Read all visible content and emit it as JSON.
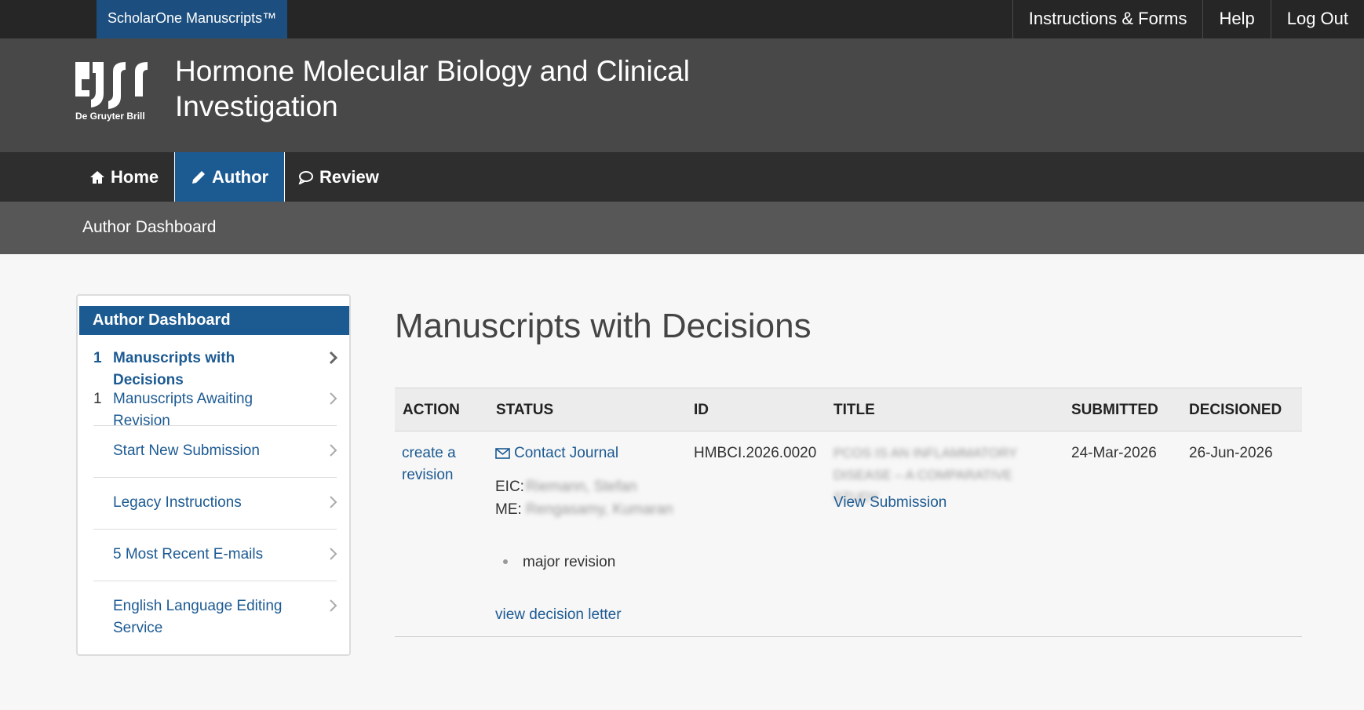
{
  "topbar": {
    "brand": "ScholarOne Manuscripts™",
    "links": [
      "Instructions & Forms",
      "Help",
      "Log Out"
    ]
  },
  "header": {
    "logo_text": "De Gruyter Brill",
    "journal_title": "Hormone Molecular Biology and Clinical Investigation"
  },
  "nav": {
    "items": [
      {
        "label": "Home",
        "icon": "home-icon"
      },
      {
        "label": "Author",
        "icon": "pencil-icon",
        "active": true
      },
      {
        "label": "Review",
        "icon": "speech-bubble-icon"
      }
    ]
  },
  "breadcrumb": "Author Dashboard",
  "sidebar": {
    "title": "Author Dashboard",
    "items": [
      {
        "count": "1",
        "label": "Manuscripts with Decisions"
      },
      {
        "count": "1",
        "label": "Manuscripts Awaiting Revision"
      },
      {
        "count": "",
        "label": "Start New Submission"
      },
      {
        "count": "",
        "label": "Legacy Instructions"
      },
      {
        "count": "",
        "label": "5 Most Recent E-mails"
      },
      {
        "count": "",
        "label": "English Language Editing Service"
      }
    ]
  },
  "main": {
    "heading": "Manuscripts with Decisions",
    "columns": [
      "ACTION",
      "STATUS",
      "ID",
      "TITLE",
      "SUBMITTED",
      "DECISIONED"
    ],
    "row": {
      "action": "create a revision",
      "contact": "Contact Journal",
      "eic_label": "EIC:",
      "eic_name": "Riemann, Stefan",
      "me_label": "ME:",
      "me_name": "Rengasamy, Kumaran",
      "decision": "major revision",
      "decision_link": "view decision letter",
      "id": "HMBCI.2026.0020",
      "title": "PCOS IS AN INFLAMMATORY DISEASE – A COMPARATIVE STUDY",
      "view_link": "View Submission",
      "submitted": "24-Mar-2026",
      "decisioned": "26-Jun-2026"
    }
  },
  "colors": {
    "brand_blue": "#1c5a92",
    "topbar": "#262626",
    "header": "#484848",
    "nav": "#2e2e2e",
    "crumbbar": "#575757"
  }
}
